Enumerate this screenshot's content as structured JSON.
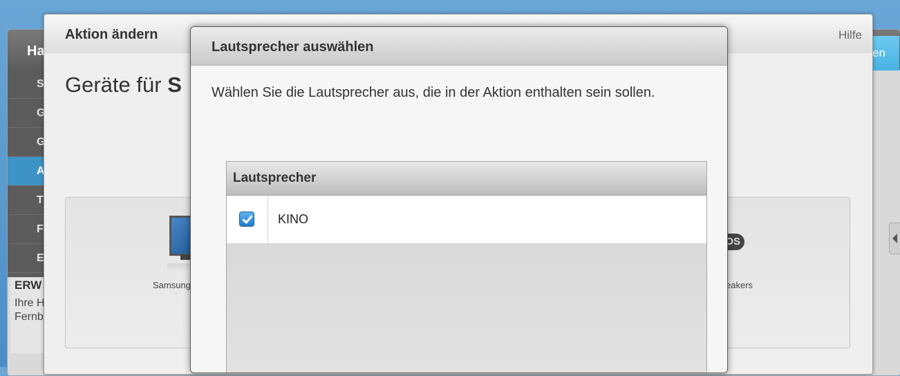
{
  "background_app": {
    "title_partial": "Ha",
    "sidebar_items": [
      {
        "label": "S",
        "active": false
      },
      {
        "label": "G",
        "active": false
      },
      {
        "label": "G",
        "active": false
      },
      {
        "label": "A",
        "active": true
      },
      {
        "label": "T",
        "active": false
      },
      {
        "label": "F",
        "active": false
      },
      {
        "label": "E",
        "active": false
      }
    ],
    "promo": {
      "title": "ERW",
      "line1": "Ihre H",
      "line2": "Fernb"
    },
    "right_button_partial": "en",
    "accent_color": "#3d93c6"
  },
  "action_window": {
    "title": "Aktion ändern",
    "help": "Hilfe",
    "subtitle_prefix": "Geräte für ",
    "subtitle_bold": "S",
    "devices": [
      {
        "label": "Samsung",
        "icon": "tv-icon"
      },
      {
        "label": "eakers",
        "icon": "sonos-speakers-icon",
        "badge": "OS"
      }
    ]
  },
  "dialog": {
    "title": "Lautsprecher auswählen",
    "description": "Wählen Sie die Lautsprecher aus, die in der Aktion enthalten sein sollen.",
    "table": {
      "header": "Lautsprecher",
      "rows": [
        {
          "name": "KINO",
          "checked": true
        }
      ]
    }
  }
}
